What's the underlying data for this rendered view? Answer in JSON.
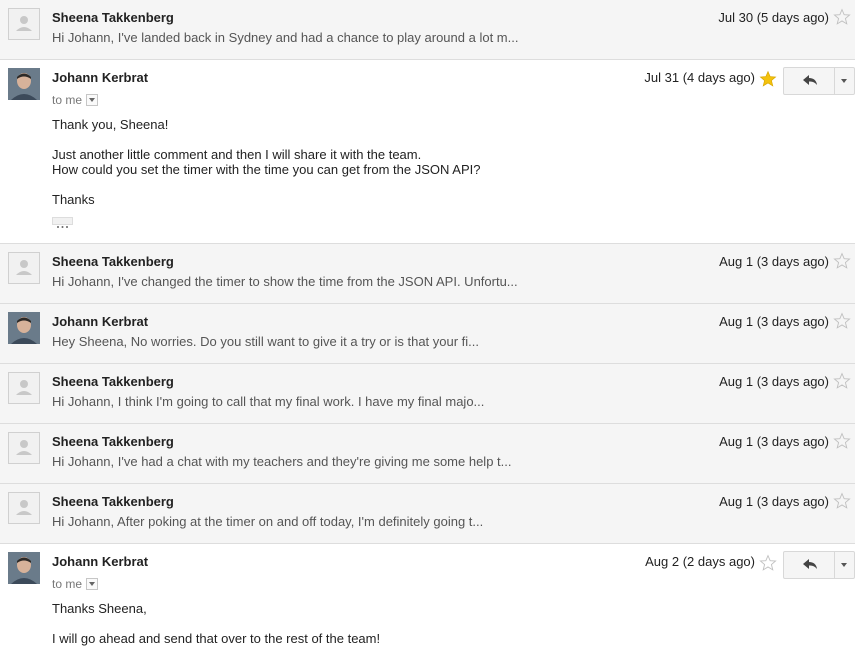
{
  "thread": {
    "m1": {
      "sender": "Sheena Takkenberg",
      "date": "Jul 30 (5 days ago)",
      "snippet": "Hi Johann, I've landed back in Sydney and had a chance to play around a lot m...",
      "starred": false
    },
    "m2": {
      "sender": "Johann Kerbrat",
      "date": "Jul 31 (4 days ago)",
      "to": "to me",
      "starred": true,
      "body": [
        "Thank you, Sheena!",
        "Just another little comment and then I will share it with the team.",
        "How could you set the timer with the time you can get from the JSON API?",
        "Thanks"
      ]
    },
    "m3": {
      "sender": "Sheena Takkenberg",
      "date": "Aug 1 (3 days ago)",
      "snippet": "Hi Johann, I've changed the timer to show the time from the JSON API. Unfortu...",
      "starred": false
    },
    "m4": {
      "sender": "Johann Kerbrat",
      "date": "Aug 1 (3 days ago)",
      "snippet": "Hey Sheena, No worries. Do you still want to give it a try or is that your fi...",
      "starred": false
    },
    "m5": {
      "sender": "Sheena Takkenberg",
      "date": "Aug 1 (3 days ago)",
      "snippet": "Hi Johann, I think I'm going to call that my final work. I have my final majo...",
      "starred": false
    },
    "m6": {
      "sender": "Sheena Takkenberg",
      "date": "Aug 1 (3 days ago)",
      "snippet": "Hi Johann, I've had a chat with my teachers and they're giving me some help t...",
      "starred": false
    },
    "m7": {
      "sender": "Sheena Takkenberg",
      "date": "Aug 1 (3 days ago)",
      "snippet": "Hi Johann, After poking at the timer on and off today, I'm definitely going t...",
      "starred": false
    },
    "m8": {
      "sender": "Johann Kerbrat",
      "date": "Aug 2 (2 days ago)",
      "to": "to me",
      "starred": false,
      "body": [
        "Thanks Sheena,",
        "I will go ahead and send that over to the rest of the team!"
      ]
    }
  },
  "colors": {
    "star_on": "#f4c20d",
    "star_off": "#c0c0c0",
    "collapsed_bg": "#f5f5f5",
    "divider": "#dddddd"
  },
  "icons": {
    "star": "star-icon",
    "reply": "reply-icon",
    "more": "chevron-down-icon",
    "avatar": "avatar"
  }
}
